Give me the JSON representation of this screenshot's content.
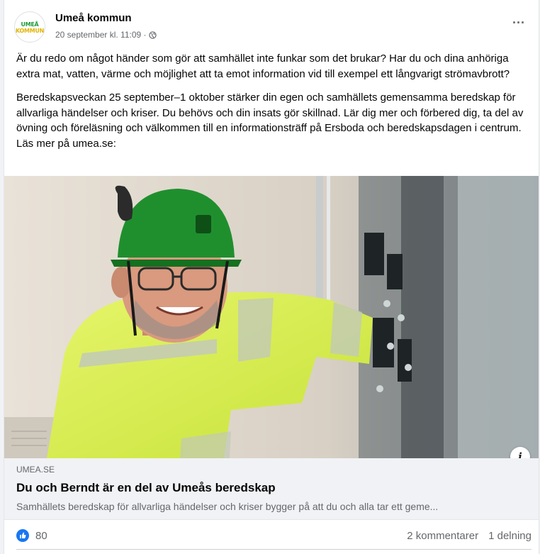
{
  "post": {
    "page_name": "Umeå kommun",
    "avatar": {
      "line1": "UMEÅ",
      "line2": "KOMMUN",
      "colors": {
        "green": "#1f9a3a",
        "yellow": "#e1b400"
      }
    },
    "timestamp": "20 september kl. 11:09 ·",
    "privacy_icon": "globe-icon",
    "more_label": "···",
    "paragraphs": [
      "Är du redo om något händer som gör att samhället inte funkar som det brukar? Har du och dina anhöriga extra mat, vatten, värme och möjlighet att ta emot information vid till exempel ett långvarigt strömavbrott?",
      "Beredskapsveckan 25 september–1 oktober stärker din egen och samhällets gemensamma beredskap för allvarliga händelser och kriser. Du behövs och din insats gör skillnad. Lär dig mer och förbered dig, ta del av övning och föreläsning och välkommen till en informationsträff på Ersboda och beredskapsdagen i centrum. Läs mer på umea.se:"
    ]
  },
  "link_preview": {
    "info_label": "i",
    "domain": "UMEA.SE",
    "title": "Du och Berndt är en del av Umeås beredskap",
    "description": "Samhällets beredskap för allvarliga händelser och kriser bygger på att du och alla tar ett geme..."
  },
  "stats": {
    "reaction_icon": "like-icon",
    "reaction_color": "#1877f2",
    "like_count": "80",
    "comments": "2 kommentarer",
    "shares": "1 delning"
  }
}
